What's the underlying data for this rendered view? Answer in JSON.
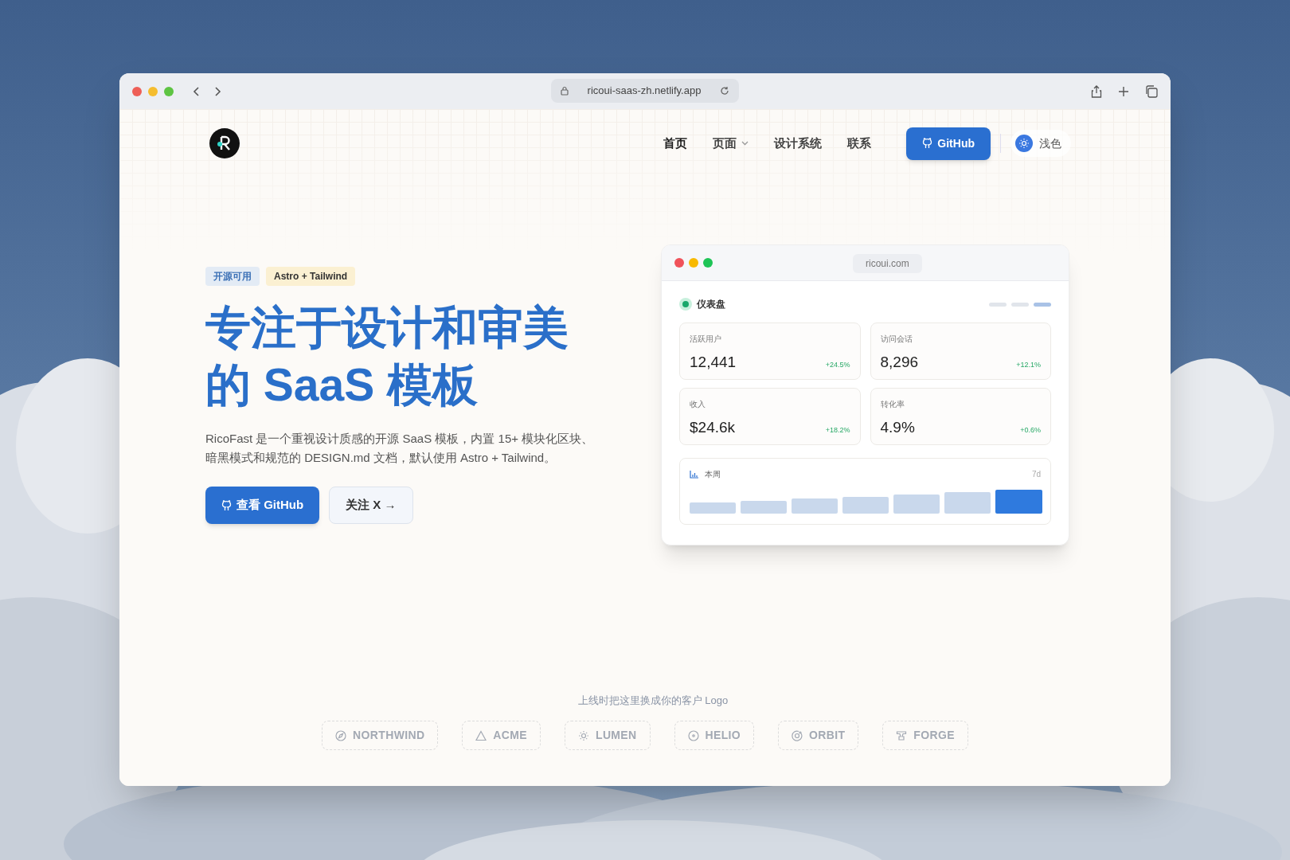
{
  "browser": {
    "url": "ricoui-saas-zh.netlify.app"
  },
  "nav": {
    "links": [
      {
        "label": "首页",
        "selected": true,
        "kind": "link"
      },
      {
        "label": "页面",
        "selected": false,
        "kind": "dropdown"
      },
      {
        "label": "设计系统",
        "selected": false,
        "kind": "link"
      },
      {
        "label": "联系",
        "selected": false,
        "kind": "link"
      }
    ],
    "github_button": "GitHub",
    "theme_toggle": "浅色"
  },
  "hero": {
    "tags": [
      {
        "label": "开源可用",
        "color": "#e3ebf5"
      },
      {
        "label": "Astro + Tailwind",
        "color": "#fbf0d2"
      }
    ],
    "title_lines": [
      "专注于设计和审美",
      "的 SaaS 模板"
    ],
    "description": "RicoFast 是一个重视设计质感的开源 SaaS 模板，内置 15+ 模块化区块、暗黑模式和规范的 DESIGN.md 文档，默认使用 Astro + Tailwind。",
    "primary_button": "查看 GitHub",
    "secondary_button": "关注 X →"
  },
  "preview": {
    "url": "ricoui.com",
    "title": "仪表盘",
    "pager": [
      {
        "selected": false
      },
      {
        "selected": false
      },
      {
        "selected": true
      }
    ],
    "stats": [
      {
        "label": "活跃用户",
        "value": "12,441",
        "change": "+24.5%"
      },
      {
        "label": "访问会话",
        "value": "8,296",
        "change": "+12.1%"
      },
      {
        "label": "收入",
        "value": "$24.6k",
        "change": "+18.2%"
      },
      {
        "label": "转化率",
        "value": "4.9%",
        "change": "+0.6%"
      }
    ],
    "chart": {
      "title": "本周",
      "range": "7d"
    }
  },
  "logos": {
    "caption": "上线时把这里换成你的客户 Logo",
    "items": [
      "NORTHWIND",
      "ACME",
      "LUMEN",
      "HELIO",
      "ORBIT",
      "FORGE"
    ]
  }
}
